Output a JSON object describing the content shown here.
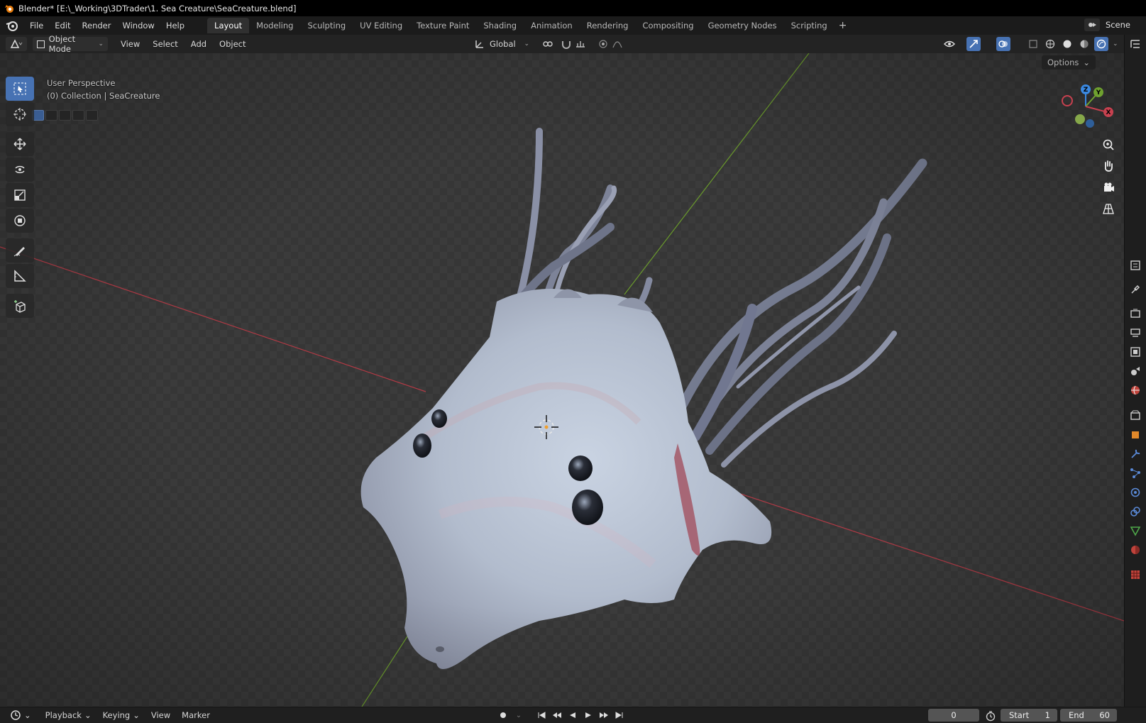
{
  "window": {
    "title": "Blender* [E:\\_Working\\3DTrader\\1. Sea Creature\\SeaCreature.blend]",
    "logo_icon": "blender-logo-icon"
  },
  "topbar": {
    "menus": [
      "File",
      "Edit",
      "Render",
      "Window",
      "Help"
    ],
    "workspace_tabs": [
      "Layout",
      "Modeling",
      "Sculpting",
      "UV Editing",
      "Texture Paint",
      "Shading",
      "Animation",
      "Rendering",
      "Compositing",
      "Geometry Nodes",
      "Scripting"
    ],
    "active_tab": "Layout",
    "add_tab_icon": "plus-icon",
    "scene_label": "Scene"
  },
  "viewport_header": {
    "mode": "Object Mode",
    "menus": [
      "View",
      "Select",
      "Add",
      "Object"
    ],
    "transform_orientation": "Global"
  },
  "viewport": {
    "perspective_label": "User Perspective",
    "collection_label": "(0) Collection | SeaCreature",
    "options_label": "Options",
    "accent_color": "#4772b3",
    "axis_x_color": "#c7414f",
    "axis_y_color": "#6fa12f",
    "axis_z_color": "#3a88e0"
  },
  "toolbar": {
    "tools": [
      "select-box-icon",
      "cursor-icon",
      "move-icon",
      "rotate-icon",
      "scale-icon",
      "transform-icon",
      "annotate-icon",
      "measure-icon",
      "add-cube-icon"
    ],
    "active_tool": "select-box-icon"
  },
  "gizmo": {
    "x_label": "X",
    "y_label": "Y",
    "z_label": "Z"
  },
  "timeline": {
    "menus": [
      "Playback",
      "Keying",
      "View",
      "Marker"
    ],
    "current_frame": "0",
    "start_label": "Start",
    "start_value": "1",
    "end_label": "End",
    "end_value": "60"
  }
}
